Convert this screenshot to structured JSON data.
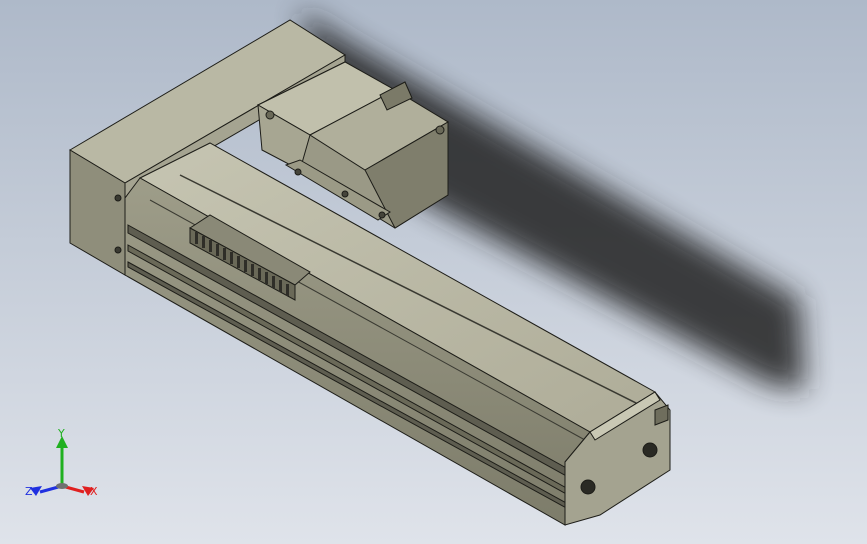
{
  "viewport": {
    "background_top": "#aeb9c9",
    "background_bottom": "#dfe3ea"
  },
  "model": {
    "body_color": "#b8b7a3",
    "side_color": "#8c8b78",
    "dark_color": "#5e5d50",
    "edge_color": "#1d1d18",
    "shadow_color": "#202020"
  },
  "triad": {
    "x_label": "X",
    "y_label": "Y",
    "z_label": "Z",
    "x_color": "#e02020",
    "y_color": "#20b020",
    "z_color": "#2030e0"
  }
}
